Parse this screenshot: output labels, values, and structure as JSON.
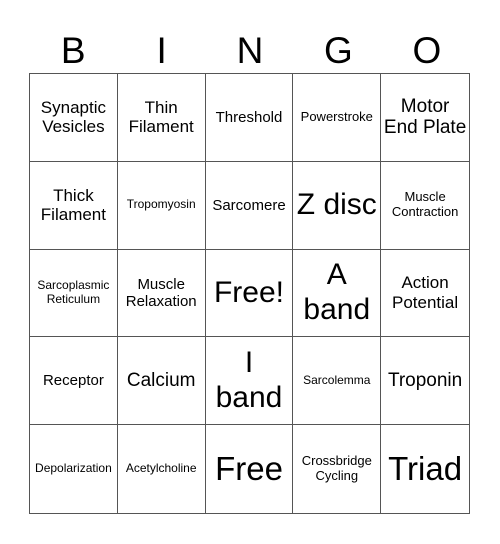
{
  "header": [
    "B",
    "I",
    "N",
    "G",
    "O"
  ],
  "cells": [
    {
      "text": "Synaptic Vesicles",
      "size": "s4"
    },
    {
      "text": "Thin Filament",
      "size": "s4"
    },
    {
      "text": "Threshold",
      "size": "s3"
    },
    {
      "text": "Powerstroke",
      "size": "s2"
    },
    {
      "text": "Motor End Plate",
      "size": "s5"
    },
    {
      "text": "Thick Filament",
      "size": "s4"
    },
    {
      "text": "Tropomyosin",
      "size": "s1"
    },
    {
      "text": "Sarcomere",
      "size": "s3"
    },
    {
      "text": "Z disc",
      "size": "s6"
    },
    {
      "text": "Muscle Contraction",
      "size": "s2"
    },
    {
      "text": "Sarcoplasmic Reticulum",
      "size": "s1"
    },
    {
      "text": "Muscle Relaxation",
      "size": "s3"
    },
    {
      "text": "Free!",
      "size": "s6"
    },
    {
      "text": "A band",
      "size": "s6"
    },
    {
      "text": "Action Potential",
      "size": "s4"
    },
    {
      "text": "Receptor",
      "size": "s3"
    },
    {
      "text": "Calcium",
      "size": "s5"
    },
    {
      "text": "I band",
      "size": "s6"
    },
    {
      "text": "Sarcolemma",
      "size": "s1"
    },
    {
      "text": "Troponin",
      "size": "s5"
    },
    {
      "text": "Depolarization",
      "size": "s1"
    },
    {
      "text": "Acetylcholine",
      "size": "s1"
    },
    {
      "text": "Free",
      "size": "s7"
    },
    {
      "text": "Crossbridge Cycling",
      "size": "s2"
    },
    {
      "text": "Triad",
      "size": "s7"
    }
  ]
}
